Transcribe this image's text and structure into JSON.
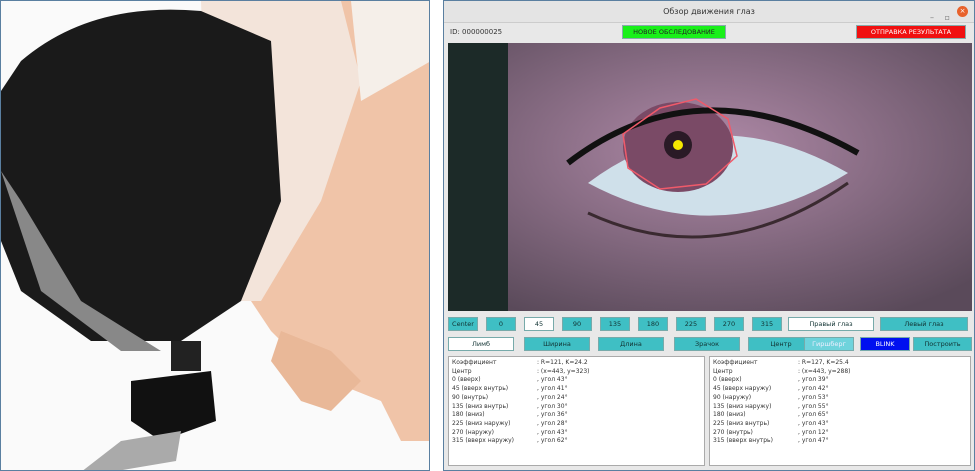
{
  "window": {
    "title": "Обзор движения глаз",
    "id_label": "ID: 000000025",
    "new_exam": "НОВОЕ ОБСЛЕДОВАНИЕ",
    "send_result": "ОТПРАВКА РЕЗУЛЬТАТА",
    "minimize": "–",
    "maximize": "▫",
    "close": "×"
  },
  "row1": [
    "Center",
    "0",
    "45",
    "90",
    "135",
    "180",
    "225",
    "270",
    "315",
    "Правый глаз",
    "Левый глаз"
  ],
  "row2": [
    "Лимб",
    "Ширина",
    "Длина",
    "Зрачок",
    "Центр",
    "Гиршберг",
    "BLINK",
    "Построить"
  ],
  "colors": {
    "green": "#19f019",
    "red": "#f01010",
    "teal": "#3fbfc4",
    "blue": "#0010f0"
  },
  "right_eye": [
    [
      "Коэффициент",
      ": R=121, K=24.2"
    ],
    [
      "Центр",
      ": (x=443, y=323)"
    ],
    [
      "0 (вверх)",
      ", угол 43°"
    ],
    [
      "45 (вверх внутрь)",
      ", угол 41°"
    ],
    [
      "90 (внутрь)",
      ", угол 24°"
    ],
    [
      "135 (вниз внутрь)",
      ", угол 30°"
    ],
    [
      "180 (вниз)",
      ", угол 36°"
    ],
    [
      "225 (вниз наружу)",
      ", угол 28°"
    ],
    [
      "270 (наружу)",
      ", угол 43°"
    ],
    [
      "315 (вверх наружу)",
      ", угол 62°"
    ]
  ],
  "left_eye": [
    [
      "Коэффициент",
      ": R=127, K=25.4"
    ],
    [
      "Центр",
      ": (x=443, y=288)"
    ],
    [
      "0 (вверх)",
      ", угол 39°"
    ],
    [
      "45 (вверх наружу)",
      ", угол 42°"
    ],
    [
      "90 (наружу)",
      ", угол 53°"
    ],
    [
      "135 (вниз наружу)",
      ", угол 55°"
    ],
    [
      "180 (вниз)",
      ", угол 65°"
    ],
    [
      "225 (вниз внутрь)",
      ", угол 43°"
    ],
    [
      "270 (внутрь)",
      ", угол 12°"
    ],
    [
      "315 (вверх внутрь)",
      ", угол 47°"
    ]
  ]
}
